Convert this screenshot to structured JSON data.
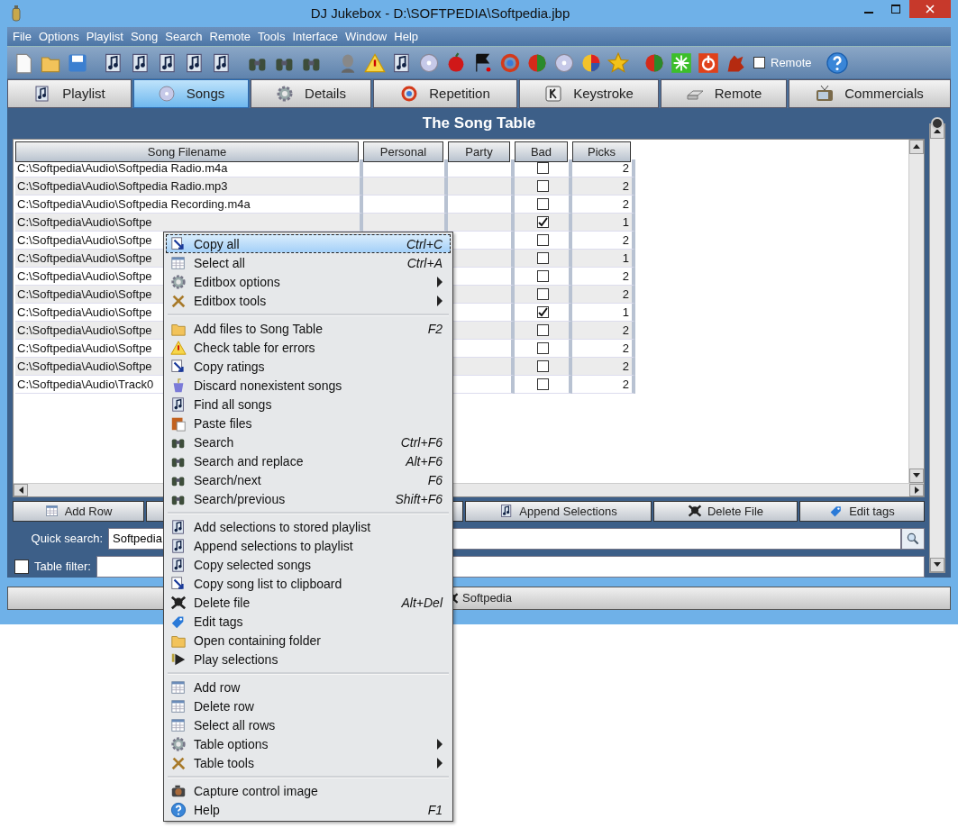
{
  "window": {
    "title": "DJ Jukebox - D:\\SOFTPEDIA\\Softpedia.jbp"
  },
  "menu_bar": [
    "File",
    "Options",
    "Playlist",
    "Song",
    "Search",
    "Remote",
    "Tools",
    "Interface",
    "Window",
    "Help"
  ],
  "toolbar": {
    "remote_checkbox": {
      "label": "Remote",
      "checked": false
    }
  },
  "tabs": [
    {
      "label": "Playlist",
      "selected": false
    },
    {
      "label": "Songs",
      "selected": true
    },
    {
      "label": "Details",
      "selected": false
    },
    {
      "label": "Repetition",
      "selected": false
    },
    {
      "label": "Keystroke",
      "selected": false
    },
    {
      "label": "Remote",
      "selected": false
    },
    {
      "label": "Commercials",
      "selected": false
    }
  ],
  "panel_title": "The Song Table",
  "table": {
    "columns": [
      "Song Filename",
      "Personal",
      "Party",
      "Bad",
      "Picks"
    ],
    "rows": [
      {
        "filename": "C:\\Softpedia\\Audio\\Softpedia Radio.m4a",
        "bad": false,
        "picks": "2"
      },
      {
        "filename": "C:\\Softpedia\\Audio\\Softpedia Radio.mp3",
        "bad": false,
        "picks": "2"
      },
      {
        "filename": "C:\\Softpedia\\Audio\\Softpedia Recording.m4a",
        "bad": false,
        "picks": "2"
      },
      {
        "filename": "C:\\Softpedia\\Audio\\Softpe",
        "bad": true,
        "picks": "1"
      },
      {
        "filename": "C:\\Softpedia\\Audio\\Softpe",
        "bad": false,
        "picks": "2"
      },
      {
        "filename": "C:\\Softpedia\\Audio\\Softpe",
        "bad": false,
        "picks": "1"
      },
      {
        "filename": "C:\\Softpedia\\Audio\\Softpe",
        "bad": false,
        "picks": "2"
      },
      {
        "filename": "C:\\Softpedia\\Audio\\Softpe",
        "bad": false,
        "picks": "2"
      },
      {
        "filename": "C:\\Softpedia\\Audio\\Softpe",
        "bad": true,
        "picks": "1"
      },
      {
        "filename": "C:\\Softpedia\\Audio\\Softpe",
        "bad": false,
        "picks": "2"
      },
      {
        "filename": "C:\\Softpedia\\Audio\\Softpe",
        "bad": false,
        "picks": "2"
      },
      {
        "filename": "C:\\Softpedia\\Audio\\Softpe",
        "bad": false,
        "picks": "2"
      },
      {
        "filename": "C:\\Softpedia\\Audio\\Track0",
        "bad": false,
        "picks": "2"
      }
    ]
  },
  "buttons": [
    "Add Row",
    "Append Selections",
    "Delete File",
    "Edit tags"
  ],
  "quick_search": {
    "label": "Quick search:",
    "value": "Softpedia"
  },
  "table_filter": {
    "label": "Table filter:",
    "checked": false
  },
  "status_bar": "Softpedia",
  "context_menu": {
    "groups": [
      [
        {
          "label": "Copy all",
          "shortcut": "Ctrl+C",
          "submenu": false,
          "selected": true
        },
        {
          "label": "Select all",
          "shortcut": "Ctrl+A",
          "submenu": false,
          "selected": false
        },
        {
          "label": "Editbox options",
          "submenu": true,
          "selected": false
        },
        {
          "label": "Editbox tools",
          "submenu": true,
          "selected": false
        }
      ],
      [
        {
          "label": "Add files to Song Table",
          "shortcut": "F2",
          "submenu": false,
          "selected": false
        },
        {
          "label": "Check table for errors",
          "submenu": false,
          "selected": false
        },
        {
          "label": "Copy ratings",
          "submenu": false,
          "selected": false
        },
        {
          "label": "Discard nonexistent songs",
          "submenu": false,
          "selected": false
        },
        {
          "label": "Find all songs",
          "submenu": false,
          "selected": false
        },
        {
          "label": "Paste files",
          "submenu": false,
          "selected": false
        },
        {
          "label": "Search",
          "shortcut": "Ctrl+F6",
          "submenu": false,
          "selected": false
        },
        {
          "label": "Search and replace",
          "shortcut": "Alt+F6",
          "submenu": false,
          "selected": false
        },
        {
          "label": "Search/next",
          "shortcut": "F6",
          "submenu": false,
          "selected": false
        },
        {
          "label": "Search/previous",
          "shortcut": "Shift+F6",
          "submenu": false,
          "selected": false
        }
      ],
      [
        {
          "label": "Add selections to stored playlist",
          "submenu": false,
          "selected": false
        },
        {
          "label": "Append selections to playlist",
          "submenu": false,
          "selected": false
        },
        {
          "label": "Copy selected songs",
          "submenu": false,
          "selected": false
        },
        {
          "label": "Copy song list to clipboard",
          "submenu": false,
          "selected": false
        },
        {
          "label": "Delete file",
          "shortcut": "Alt+Del",
          "submenu": false,
          "selected": false
        },
        {
          "label": "Edit tags",
          "submenu": false,
          "selected": false
        },
        {
          "label": "Open containing folder",
          "submenu": false,
          "selected": false
        },
        {
          "label": "Play selections",
          "submenu": false,
          "selected": false
        }
      ],
      [
        {
          "label": "Add row",
          "submenu": false,
          "selected": false
        },
        {
          "label": "Delete row",
          "submenu": false,
          "selected": false
        },
        {
          "label": "Select all rows",
          "submenu": false,
          "selected": false
        },
        {
          "label": "Table options",
          "submenu": true,
          "selected": false
        },
        {
          "label": "Table tools",
          "submenu": true,
          "selected": false
        }
      ],
      [
        {
          "label": "Capture control image",
          "submenu": false,
          "selected": false
        },
        {
          "label": "Help",
          "shortcut": "F1",
          "submenu": false,
          "selected": false
        }
      ]
    ]
  }
}
